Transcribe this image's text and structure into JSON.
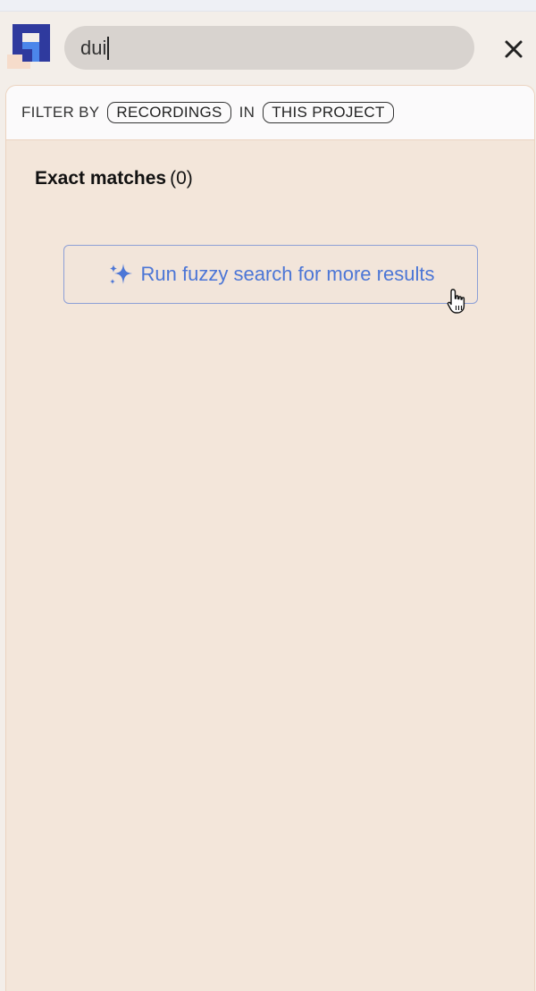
{
  "search": {
    "value": "dui"
  },
  "filter": {
    "prefix": "FILTER BY",
    "type_chip": "RECORDINGS",
    "in_word": "IN",
    "scope_chip": "THIS PROJECT"
  },
  "results": {
    "heading": "Exact matches",
    "count": "(0)"
  },
  "fuzzy_button": {
    "label": "Run fuzzy search for more results",
    "icon": "sparkle-icon"
  },
  "icons": {
    "logo": "app-logo",
    "close": "close-icon",
    "pointer": "hand-pointer-icon"
  },
  "colors": {
    "accent": "#4c76d6",
    "panel_bg": "#f3e6da",
    "search_bg": "#d8d3cf",
    "logo_dark": "#2f3a9e",
    "logo_light": "#4c86ea"
  }
}
